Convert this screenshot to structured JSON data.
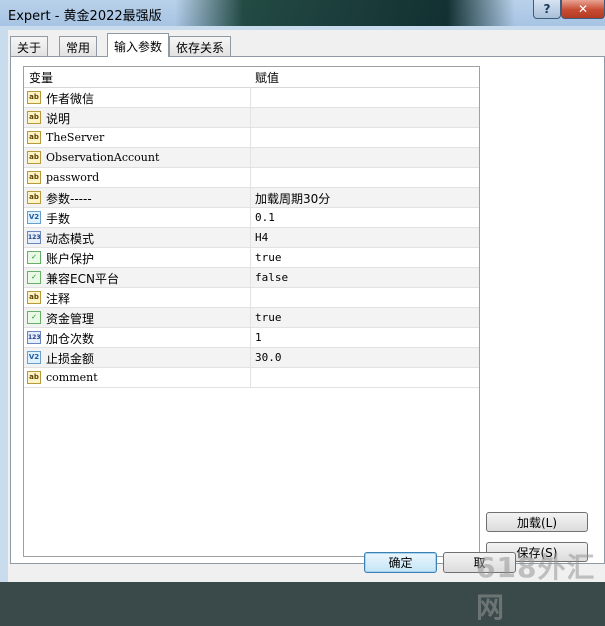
{
  "window": {
    "title": "Expert - 黄金2022最强版",
    "help_label": "?",
    "close_label": "✕"
  },
  "tabs": [
    {
      "label": "关于"
    },
    {
      "label": "常用"
    },
    {
      "label": "输入参数"
    },
    {
      "label": "依存关系"
    }
  ],
  "grid": {
    "header": {
      "variable": "变量",
      "value": "赋值"
    },
    "rows": [
      {
        "icon": "string-icon",
        "icon_text": "ab",
        "name": "作者微信",
        "value": ""
      },
      {
        "icon": "string-icon",
        "icon_text": "ab",
        "name": "说明",
        "value": ""
      },
      {
        "icon": "string-icon",
        "icon_text": "ab",
        "name": "TheServer",
        "value": ""
      },
      {
        "icon": "string-icon",
        "icon_text": "ab",
        "name": "ObservationAccount",
        "value": ""
      },
      {
        "icon": "string-icon",
        "icon_text": "ab",
        "name": "password",
        "value": ""
      },
      {
        "icon": "string-icon",
        "icon_text": "ab",
        "name": "参数-----",
        "value": "加载周期30分"
      },
      {
        "icon": "double-icon",
        "icon_text": "V2",
        "name": "手数",
        "value": "0.1"
      },
      {
        "icon": "integer-icon",
        "icon_text": "123",
        "name": "动态模式",
        "value": "H4"
      },
      {
        "icon": "bool-icon",
        "icon_text": "✓",
        "name": "账户保护",
        "value": "true"
      },
      {
        "icon": "bool-icon",
        "icon_text": "✓",
        "name": "兼容ECN平台",
        "value": "false"
      },
      {
        "icon": "string-icon",
        "icon_text": "ab",
        "name": "注释",
        "value": ""
      },
      {
        "icon": "bool-icon",
        "icon_text": "✓",
        "name": "资金管理",
        "value": "true"
      },
      {
        "icon": "integer-icon",
        "icon_text": "123",
        "name": "加仓次数",
        "value": "1"
      },
      {
        "icon": "double-icon",
        "icon_text": "V2",
        "name": "止损金额",
        "value": "30.0"
      },
      {
        "icon": "string-icon",
        "icon_text": "ab",
        "name": "comment",
        "value": ""
      }
    ]
  },
  "buttons": {
    "load": "加载(L)",
    "save": "保存(S)",
    "ok": "确定",
    "cancel": "取"
  },
  "watermark": "618外汇网"
}
